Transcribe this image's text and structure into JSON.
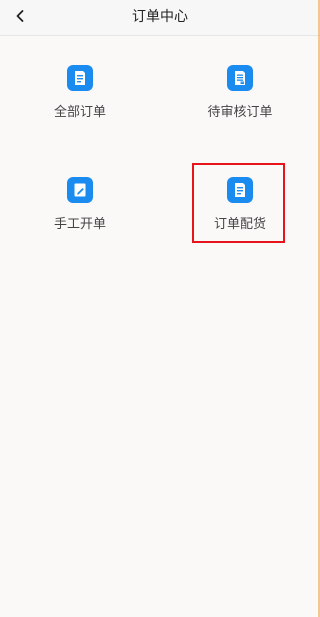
{
  "header": {
    "title": "订单中心",
    "back_icon": "chevron-left-icon"
  },
  "menu": {
    "items": [
      {
        "label": "全部订单",
        "icon": "document-list-icon"
      },
      {
        "label": "待审核订单",
        "icon": "document-review-icon"
      },
      {
        "label": "手工开单",
        "icon": "document-edit-icon"
      },
      {
        "label": "订单配货",
        "icon": "document-list-icon"
      }
    ]
  },
  "colors": {
    "accent": "#1a8cf0",
    "highlight": "#e8141c",
    "background": "#fbf8f8"
  }
}
